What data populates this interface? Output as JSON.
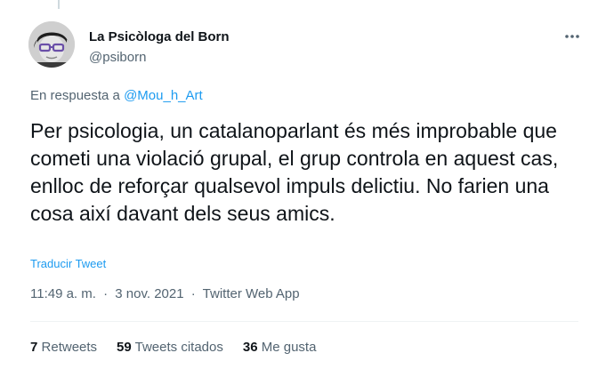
{
  "author": {
    "name": "La Psicòloga del Born",
    "handle": "@psiborn"
  },
  "reply": {
    "prefix": "En respuesta a",
    "mention": "@Mou_h_Art"
  },
  "tweet": {
    "text": "Per psicologia, un catalanoparlant és més improbable que cometi una violació grupal, el grup controla en aquest cas, enlloc de reforçar qualsevol impuls delictiu. No farien una cosa així davant dels seus amics.",
    "translate_label": "Traducir Tweet"
  },
  "meta": {
    "time": "11:49 a. m.",
    "separator": "·",
    "date": "3 nov. 2021",
    "source": "Twitter Web App"
  },
  "stats": {
    "retweets_count": "7",
    "retweets_label": "Retweets",
    "quotes_count": "59",
    "quotes_label": "Tweets citados",
    "likes_count": "36",
    "likes_label": "Me gusta"
  },
  "colors": {
    "accent": "#1d9bf0",
    "text_primary": "#0f1419",
    "text_secondary": "#536471",
    "divider": "#eff3f4"
  },
  "icons": {
    "more": "more-dots-icon"
  }
}
